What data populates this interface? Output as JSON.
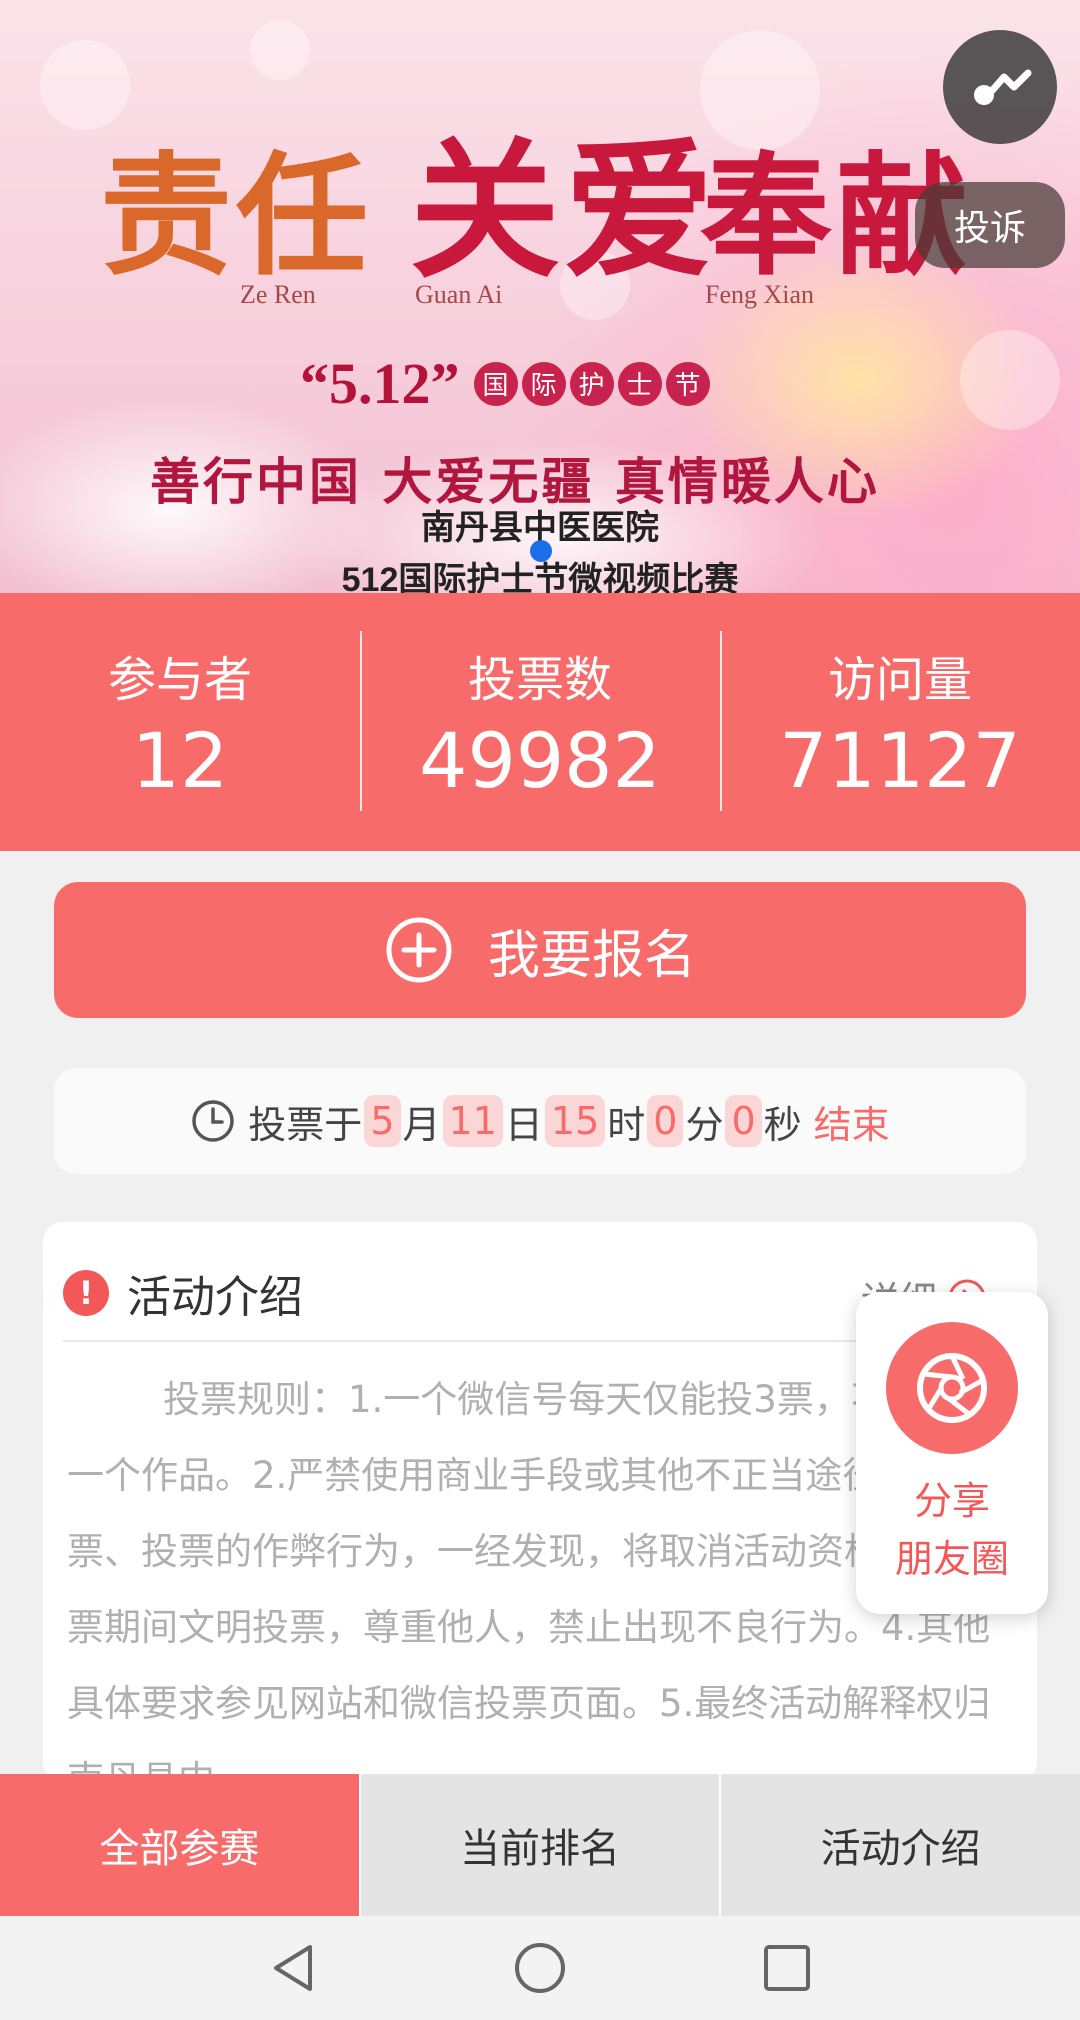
{
  "banner": {
    "title_words": [
      "责任",
      "关爱",
      "奉献"
    ],
    "pinyin": [
      "Ze Ren",
      "Guan Ai",
      "Feng Xian"
    ],
    "festival_number": "“5.12”",
    "festival_chars": [
      "国",
      "际",
      "护",
      "士",
      "节"
    ],
    "slogan": "善行中国  大爱无疆  真情暖人心",
    "hospital": "南丹县中医医院",
    "contest": "512国际护士节微视频比赛",
    "complain_label": "投诉"
  },
  "stats": [
    {
      "label": "参与者",
      "value": "12"
    },
    {
      "label": "投票数",
      "value": "49982"
    },
    {
      "label": "访问量",
      "value": "71127"
    }
  ],
  "register": {
    "label": "我要报名"
  },
  "countdown": {
    "prefix": "投票于",
    "month": "5",
    "month_unit": "月",
    "day": "11",
    "day_unit": "日",
    "hour": "15",
    "hour_unit": "时",
    "minute": "0",
    "minute_unit": "分",
    "second": "0",
    "second_unit": "秒",
    "suffix": "结束"
  },
  "intro": {
    "title": "活动介绍",
    "detail": "详细",
    "body": "投票规则：1.一个微信号每天仅能投3票，不能投同一个作品。2.严禁使用商业手段或其他不正当途径进行拉票、投票的作弊行为，一经发现，将取消活动资格。3.投票期间文明投票，尊重他人，禁止出现不良行为。4.其他具体要求参见网站和微信投票页面。5.最终活动解释权归南丹县中"
  },
  "share": {
    "line1": "分享",
    "line2": "朋友圈"
  },
  "tabs": [
    {
      "label": "全部参赛",
      "active": true
    },
    {
      "label": "当前排名",
      "active": false
    },
    {
      "label": "活动介绍",
      "active": false
    }
  ],
  "colors": {
    "accent": "#f86b6b",
    "banner_title_red": "#c8183c",
    "banner_title_orange": "#d9682a"
  }
}
